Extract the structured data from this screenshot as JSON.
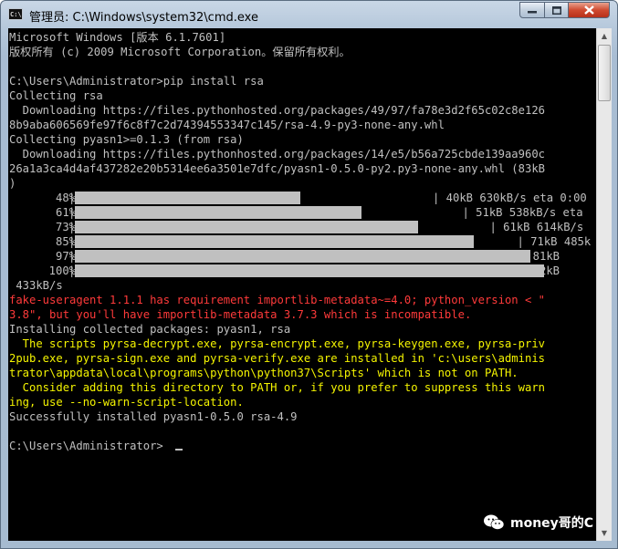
{
  "window": {
    "title": "管理员: C:\\Windows\\system32\\cmd.exe",
    "icon": "cmd-icon",
    "buttons": {
      "minimize": "minimize-icon",
      "maximize": "maximize-icon",
      "close": "close-icon"
    }
  },
  "console": {
    "lines": [
      {
        "text": "Microsoft Windows [版本 6.1.7601]",
        "color": "default"
      },
      {
        "text": "版权所有 (c) 2009 Microsoft Corporation。保留所有权利。",
        "color": "default"
      },
      {
        "text": "",
        "color": "default"
      },
      {
        "text": "C:\\Users\\Administrator>pip install rsa",
        "color": "default"
      },
      {
        "text": "Collecting rsa",
        "color": "default"
      },
      {
        "text": "  Downloading https://files.pythonhosted.org/packages/49/97/fa78e3d2f65c02c8e126",
        "color": "default"
      },
      {
        "text": "8b9aba606569fe97f6c8f7c2d74394553347c145/rsa-4.9-py3-none-any.whl",
        "color": "default"
      },
      {
        "text": "Collecting pyasn1>=0.1.3 (from rsa)",
        "color": "default"
      },
      {
        "text": "  Downloading https://files.pythonhosted.org/packages/14/e5/b56a725cbde139aa960c",
        "color": "default"
      },
      {
        "text": "26a1a3ca4d4af437282e20b5314ee6a3501e7dfc/pyasn1-0.5.0-py2.py3-none-any.whl (83kB",
        "color": "default"
      },
      {
        "text": ")",
        "color": "default"
      }
    ],
    "progress": [
      {
        "percent_label": "48%",
        "fill_fraction": 0.48,
        "tail": "| 40kB 630kB/s eta 0:00"
      },
      {
        "percent_label": "61%",
        "fill_fraction": 0.61,
        "tail": "| 51kB 538kB/s eta"
      },
      {
        "percent_label": "73%",
        "fill_fraction": 0.73,
        "tail": "| 61kB 614kB/s"
      },
      {
        "percent_label": "85%",
        "fill_fraction": 0.85,
        "tail": "| 71kB 485k"
      },
      {
        "percent_label": "97%",
        "fill_fraction": 0.97,
        "tail": "| 81kB"
      },
      {
        "percent_label": "100%",
        "fill_fraction": 1.0,
        "tail": "| 92kB"
      }
    ],
    "after_lines": [
      {
        "text": " 433kB/s",
        "color": "default"
      },
      {
        "text": "fake-useragent 1.1.1 has requirement importlib-metadata~=4.0; python_version < \"",
        "color": "red"
      },
      {
        "text": "3.8\", but you'll have importlib-metadata 3.7.3 which is incompatible.",
        "color": "red"
      },
      {
        "text": "Installing collected packages: pyasn1, rsa",
        "color": "default"
      },
      {
        "text": "  The scripts pyrsa-decrypt.exe, pyrsa-encrypt.exe, pyrsa-keygen.exe, pyrsa-priv",
        "color": "yellow"
      },
      {
        "text": "2pub.exe, pyrsa-sign.exe and pyrsa-verify.exe are installed in 'c:\\users\\adminis",
        "color": "yellow"
      },
      {
        "text": "trator\\appdata\\local\\programs\\python\\python37\\Scripts' which is not on PATH.",
        "color": "yellow"
      },
      {
        "text": "  Consider adding this directory to PATH or, if you prefer to suppress this warn",
        "color": "yellow"
      },
      {
        "text": "ing, use --no-warn-script-location.",
        "color": "yellow"
      },
      {
        "text": "Successfully installed pyasn1-0.5.0 rsa-4.9",
        "color": "default"
      },
      {
        "text": "",
        "color": "default"
      },
      {
        "text": "C:\\Users\\Administrator>",
        "color": "default"
      }
    ]
  },
  "colors": {
    "default": "#c0c0c0",
    "red": "#ff3a3a",
    "yellow": "#f4f400",
    "background": "#000000"
  },
  "watermark": {
    "text": "money哥的C",
    "icon": "wechat-icon"
  }
}
